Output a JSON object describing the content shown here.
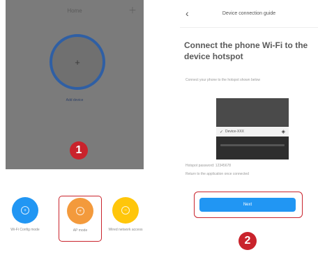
{
  "left": {
    "title": "Home",
    "menu_icon": "plus-icon",
    "add_caption": "Add device",
    "badge": "1",
    "modes": [
      {
        "label": "Wi-Fi Config mode",
        "color": "#2196f3"
      },
      {
        "label": "AP mode",
        "color": "#f39a3c"
      },
      {
        "label": "Wired network access",
        "color": "#ffc60a"
      }
    ]
  },
  "right": {
    "title": "Device connection guide",
    "headline": "Connect the phone Wi-Fi to the device hotspot",
    "instruction_1": "Connect your phone to the hotspot shown below",
    "wifi_ssid": "Device-XXX",
    "instruction_2": "Hotspot password: 12345678",
    "instruction_3": "Return to the application once connected",
    "next_label": "Next",
    "badge": "2"
  },
  "colors": {
    "highlight": "#c9232c",
    "accent_blue": "#2196f3",
    "overlay_gray": "#7b7b7b"
  }
}
